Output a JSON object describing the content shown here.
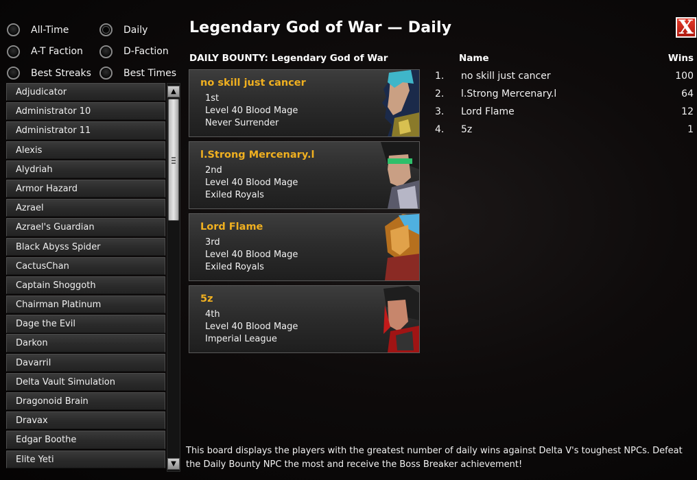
{
  "filters": [
    {
      "label": "All-Time",
      "selected": false
    },
    {
      "label": "Daily",
      "selected": true
    },
    {
      "label": "A-T Faction",
      "selected": false
    },
    {
      "label": "D-Faction",
      "selected": false
    },
    {
      "label": "Best Streaks",
      "selected": false
    },
    {
      "label": "Best Times",
      "selected": false
    }
  ],
  "npc_list": [
    "Adjudicator",
    "Administrator 10",
    "Administrator 11",
    "Alexis",
    "Alydriah",
    "Armor Hazard",
    "Azrael",
    "Azrael's Guardian",
    "Black Abyss Spider",
    "CactusChan",
    "Captain Shoggoth",
    "Chairman Platinum",
    "Dage the Evil",
    "Darkon",
    "Davarril",
    "Delta Vault Simulation",
    "Dragonoid Brain",
    "Dravax",
    "Edgar Boothe",
    "Elite Yeti"
  ],
  "title": "Legendary God of War — Daily",
  "close_label": "X",
  "bounty_header": "DAILY BOUNTY: Legendary God of War",
  "cards": [
    {
      "name": "no skill just cancer",
      "place": "1st",
      "level": "Level 40 Blood Mage",
      "faction": "Never Surrender"
    },
    {
      "name": "l.Strong Mercenary.l",
      "place": "2nd",
      "level": "Level 40 Blood Mage",
      "faction": "Exiled Royals"
    },
    {
      "name": "Lord Flame",
      "place": "3rd",
      "level": "Level 40 Blood Mage",
      "faction": "Exiled Royals"
    },
    {
      "name": "5z",
      "place": "4th",
      "level": "Level 40 Blood Mage",
      "faction": "Imperial League"
    }
  ],
  "board": {
    "head_name": "Name",
    "head_wins": "Wins",
    "rows": [
      {
        "rank": "1.",
        "name": "no skill just cancer",
        "wins": "100"
      },
      {
        "rank": "2.",
        "name": "l.Strong Mercenary.l",
        "wins": "64"
      },
      {
        "rank": "3.",
        "name": "Lord Flame",
        "wins": "12"
      },
      {
        "rank": "4.",
        "name": "5z",
        "wins": "1"
      }
    ]
  },
  "footer": "This board displays the players with the greatest number of daily wins against Delta V's toughest NPCs. Defeat the Daily Bounty NPC the most and receive the Boss Breaker achievement!",
  "colors": {
    "accent_gold": "#f0b020",
    "close_red": "#d02818"
  }
}
